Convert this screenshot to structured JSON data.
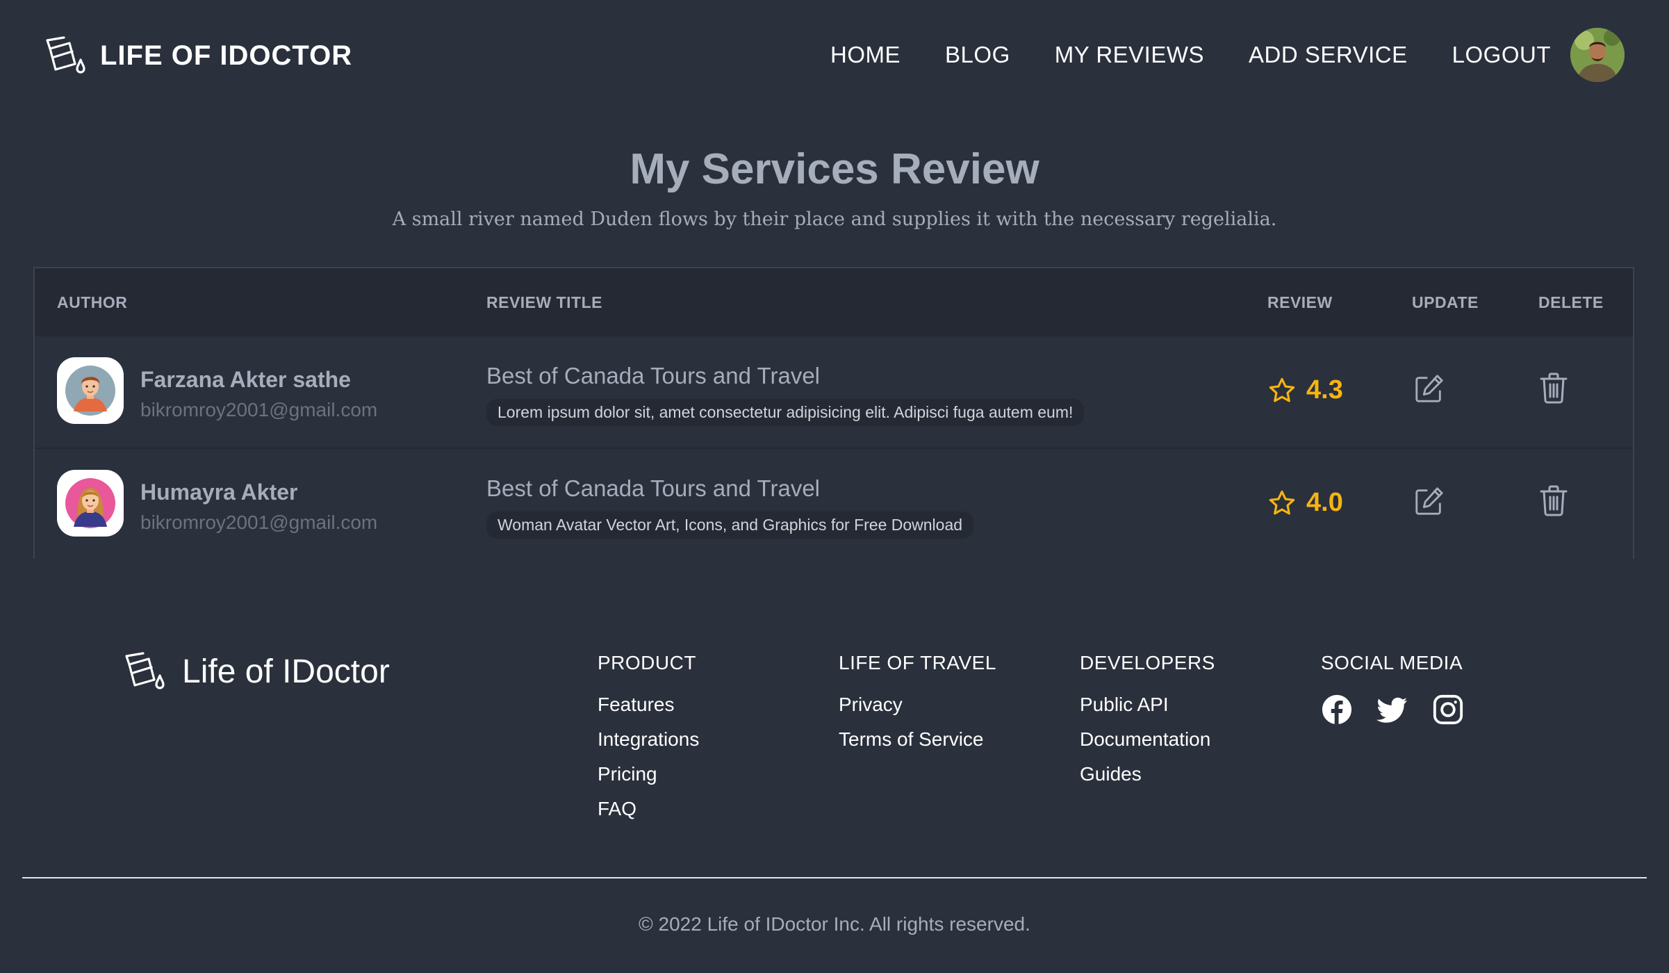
{
  "nav": {
    "brand": "LIFE OF IDOCTOR",
    "links": [
      "HOME",
      "BLOG",
      "MY REVIEWS",
      "ADD SERVICE",
      "LOGOUT"
    ]
  },
  "header": {
    "title": "My Services Review",
    "subtitle": "A small river named Duden flows by their place and supplies it with the necessary regelialia."
  },
  "table": {
    "headers": [
      "AUTHOR",
      "REVIEW TITLE",
      "REVIEW",
      "UPDATE",
      "DELETE"
    ],
    "rows": [
      {
        "author_name": "Farzana Akter sathe",
        "author_email": "bikromroy2001@gmail.com",
        "review_title": "Best of Canada Tours and Travel",
        "review_desc": "Lorem ipsum dolor sit, amet consectetur adipisicing elit. Adipisci fuga autem eum!",
        "rating": "4.3"
      },
      {
        "author_name": "Humayra Akter",
        "author_email": "bikromroy2001@gmail.com",
        "review_title": "Best of Canada Tours and Travel",
        "review_desc": "Woman Avatar Vector Art, Icons, and Graphics for Free Download",
        "rating": "4.0"
      }
    ]
  },
  "footer": {
    "brand": "Life of IDoctor",
    "columns": [
      {
        "title": "PRODUCT",
        "links": [
          "Features",
          "Integrations",
          "Pricing",
          "FAQ"
        ]
      },
      {
        "title": "LIFE OF TRAVEL",
        "links": [
          "Privacy",
          "Terms of Service"
        ]
      },
      {
        "title": "DEVELOPERS",
        "links": [
          "Public API",
          "Documentation",
          "Guides"
        ]
      },
      {
        "title": "SOCIAL MEDIA",
        "icons": [
          "facebook-icon",
          "twitter-icon",
          "instagram-icon"
        ]
      }
    ],
    "copyright": "© 2022 Life of IDoctor Inc. All rights reserved."
  },
  "colors": {
    "background": "#2a303c",
    "table_header": "#242933",
    "rating": "#f6b511",
    "muted_text": "#a6adbb"
  }
}
